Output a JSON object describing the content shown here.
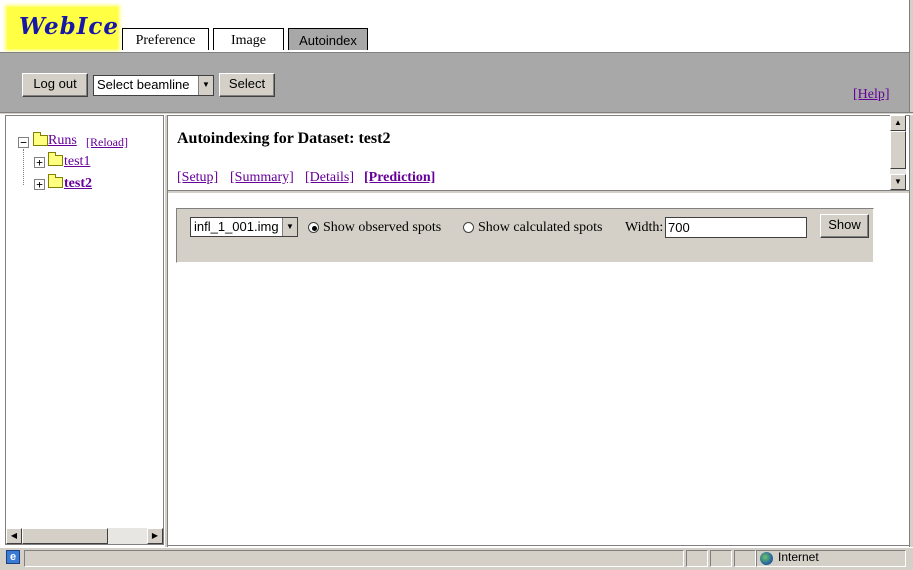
{
  "app": {
    "logo_text": "WebIce"
  },
  "tabs": [
    {
      "label": "Preference"
    },
    {
      "label": "Image"
    },
    {
      "label": "Autoindex"
    }
  ],
  "toolbar": {
    "logout_label": "Log out",
    "beamline_value": "Select beamline",
    "select_label": "Select",
    "help_label": "[Help]"
  },
  "tree": {
    "root_label": "Runs",
    "reload_label": "[Reload]",
    "items": [
      {
        "label": "test1"
      },
      {
        "label": "test2"
      }
    ]
  },
  "header": {
    "title": "Autoindexing for Dataset: test2",
    "links": [
      {
        "label": "[Setup]"
      },
      {
        "label": "[Summary]"
      },
      {
        "label": "[Details]"
      },
      {
        "label": "[Prediction]"
      }
    ]
  },
  "controls": {
    "image_value": "infl_1_001.img",
    "radio_observed": "Show observed spots",
    "radio_calculated": "Show calculated spots",
    "width_label": "Width:",
    "width_value": "700",
    "show_label": "Show"
  },
  "status": {
    "zone_label": "Internet"
  }
}
